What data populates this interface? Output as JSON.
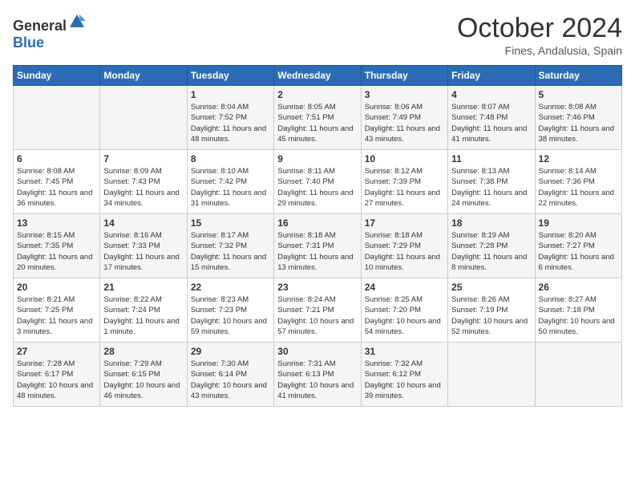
{
  "header": {
    "logo_general": "General",
    "logo_blue": "Blue",
    "month": "October 2024",
    "location": "Fines, Andalusia, Spain"
  },
  "days_of_week": [
    "Sunday",
    "Monday",
    "Tuesday",
    "Wednesday",
    "Thursday",
    "Friday",
    "Saturday"
  ],
  "weeks": [
    [
      {
        "day": null,
        "content": null
      },
      {
        "day": null,
        "content": null
      },
      {
        "day": "1",
        "content": "Sunrise: 8:04 AM\nSunset: 7:52 PM\nDaylight: 11 hours and 48 minutes."
      },
      {
        "day": "2",
        "content": "Sunrise: 8:05 AM\nSunset: 7:51 PM\nDaylight: 11 hours and 45 minutes."
      },
      {
        "day": "3",
        "content": "Sunrise: 8:06 AM\nSunset: 7:49 PM\nDaylight: 11 hours and 43 minutes."
      },
      {
        "day": "4",
        "content": "Sunrise: 8:07 AM\nSunset: 7:48 PM\nDaylight: 11 hours and 41 minutes."
      },
      {
        "day": "5",
        "content": "Sunrise: 8:08 AM\nSunset: 7:46 PM\nDaylight: 11 hours and 38 minutes."
      }
    ],
    [
      {
        "day": "6",
        "content": "Sunrise: 8:08 AM\nSunset: 7:45 PM\nDaylight: 11 hours and 36 minutes."
      },
      {
        "day": "7",
        "content": "Sunrise: 8:09 AM\nSunset: 7:43 PM\nDaylight: 11 hours and 34 minutes."
      },
      {
        "day": "8",
        "content": "Sunrise: 8:10 AM\nSunset: 7:42 PM\nDaylight: 11 hours and 31 minutes."
      },
      {
        "day": "9",
        "content": "Sunrise: 8:11 AM\nSunset: 7:40 PM\nDaylight: 11 hours and 29 minutes."
      },
      {
        "day": "10",
        "content": "Sunrise: 8:12 AM\nSunset: 7:39 PM\nDaylight: 11 hours and 27 minutes."
      },
      {
        "day": "11",
        "content": "Sunrise: 8:13 AM\nSunset: 7:38 PM\nDaylight: 11 hours and 24 minutes."
      },
      {
        "day": "12",
        "content": "Sunrise: 8:14 AM\nSunset: 7:36 PM\nDaylight: 11 hours and 22 minutes."
      }
    ],
    [
      {
        "day": "13",
        "content": "Sunrise: 8:15 AM\nSunset: 7:35 PM\nDaylight: 11 hours and 20 minutes."
      },
      {
        "day": "14",
        "content": "Sunrise: 8:16 AM\nSunset: 7:33 PM\nDaylight: 11 hours and 17 minutes."
      },
      {
        "day": "15",
        "content": "Sunrise: 8:17 AM\nSunset: 7:32 PM\nDaylight: 11 hours and 15 minutes."
      },
      {
        "day": "16",
        "content": "Sunrise: 8:18 AM\nSunset: 7:31 PM\nDaylight: 11 hours and 13 minutes."
      },
      {
        "day": "17",
        "content": "Sunrise: 8:18 AM\nSunset: 7:29 PM\nDaylight: 11 hours and 10 minutes."
      },
      {
        "day": "18",
        "content": "Sunrise: 8:19 AM\nSunset: 7:28 PM\nDaylight: 11 hours and 8 minutes."
      },
      {
        "day": "19",
        "content": "Sunrise: 8:20 AM\nSunset: 7:27 PM\nDaylight: 11 hours and 6 minutes."
      }
    ],
    [
      {
        "day": "20",
        "content": "Sunrise: 8:21 AM\nSunset: 7:25 PM\nDaylight: 11 hours and 3 minutes."
      },
      {
        "day": "21",
        "content": "Sunrise: 8:22 AM\nSunset: 7:24 PM\nDaylight: 11 hours and 1 minute."
      },
      {
        "day": "22",
        "content": "Sunrise: 8:23 AM\nSunset: 7:23 PM\nDaylight: 10 hours and 59 minutes."
      },
      {
        "day": "23",
        "content": "Sunrise: 8:24 AM\nSunset: 7:21 PM\nDaylight: 10 hours and 57 minutes."
      },
      {
        "day": "24",
        "content": "Sunrise: 8:25 AM\nSunset: 7:20 PM\nDaylight: 10 hours and 54 minutes."
      },
      {
        "day": "25",
        "content": "Sunrise: 8:26 AM\nSunset: 7:19 PM\nDaylight: 10 hours and 52 minutes."
      },
      {
        "day": "26",
        "content": "Sunrise: 8:27 AM\nSunset: 7:18 PM\nDaylight: 10 hours and 50 minutes."
      }
    ],
    [
      {
        "day": "27",
        "content": "Sunrise: 7:28 AM\nSunset: 6:17 PM\nDaylight: 10 hours and 48 minutes."
      },
      {
        "day": "28",
        "content": "Sunrise: 7:29 AM\nSunset: 6:15 PM\nDaylight: 10 hours and 46 minutes."
      },
      {
        "day": "29",
        "content": "Sunrise: 7:30 AM\nSunset: 6:14 PM\nDaylight: 10 hours and 43 minutes."
      },
      {
        "day": "30",
        "content": "Sunrise: 7:31 AM\nSunset: 6:13 PM\nDaylight: 10 hours and 41 minutes."
      },
      {
        "day": "31",
        "content": "Sunrise: 7:32 AM\nSunset: 6:12 PM\nDaylight: 10 hours and 39 minutes."
      },
      {
        "day": null,
        "content": null
      },
      {
        "day": null,
        "content": null
      }
    ]
  ]
}
